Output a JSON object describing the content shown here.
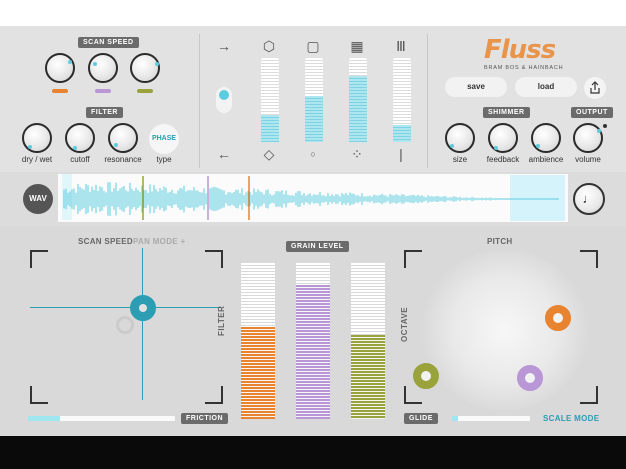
{
  "app": {
    "name": "Fluss",
    "byline": "BRAM BOS & HAINBACH"
  },
  "colors": {
    "teal": "#2c9db3",
    "cyan": "#5ccce0",
    "orange": "#e8832f",
    "purple": "#b996d6",
    "olive": "#9aa33b",
    "panel": "#e2e2e2"
  },
  "top": {
    "scan_speed": {
      "label": "SCAN SPEED",
      "swatches": [
        "orange",
        "purple",
        "olive"
      ]
    },
    "filter": {
      "label": "FILTER",
      "knobs": [
        {
          "label": "dry / wet"
        },
        {
          "label": "cutoff"
        },
        {
          "label": "resonance"
        }
      ],
      "phase_button": "PHASE",
      "phase_label": "type"
    },
    "grain_shapes": {
      "top_icons": [
        "arrow-right-icon",
        "cube-icon",
        "rounded-square-icon",
        "checker-icon",
        "bars-icon"
      ],
      "bottom_icons": [
        "arrow-left-icon",
        "drop-icon",
        "small-circle-icon",
        "dots-icon",
        "line-icon"
      ],
      "levels": [
        0.32,
        0.55,
        0.78,
        0.2
      ]
    },
    "buttons": {
      "save": "save",
      "load": "load"
    },
    "shimmer": {
      "label": "SHIMMER",
      "knobs": [
        {
          "label": "size"
        },
        {
          "label": "feedback"
        },
        {
          "label": "ambience"
        }
      ]
    },
    "output": {
      "label": "OUTPUT",
      "knob_label": "volume"
    }
  },
  "wave": {
    "wav_button": "WAV",
    "note_icon": "♩"
  },
  "bottom": {
    "left": {
      "scan_speed_label": "SCAN SPEED",
      "pan_mode_label": "PAN MODE +",
      "filter_label": "FILTER",
      "friction_label": "FRICTION",
      "friction_level": 0.22
    },
    "grain_level": {
      "label": "GRAIN LEVEL",
      "levels": [
        0.59,
        0.86,
        0.54
      ],
      "colors": [
        "#e8832f",
        "#b996d6",
        "#9aa33b"
      ]
    },
    "pitch": {
      "label": "PITCH",
      "octave_label": "OCTAVE",
      "glide_label": "GLIDE",
      "glide_level": 0.08,
      "scale_mode_label": "SCALE MODE"
    }
  }
}
